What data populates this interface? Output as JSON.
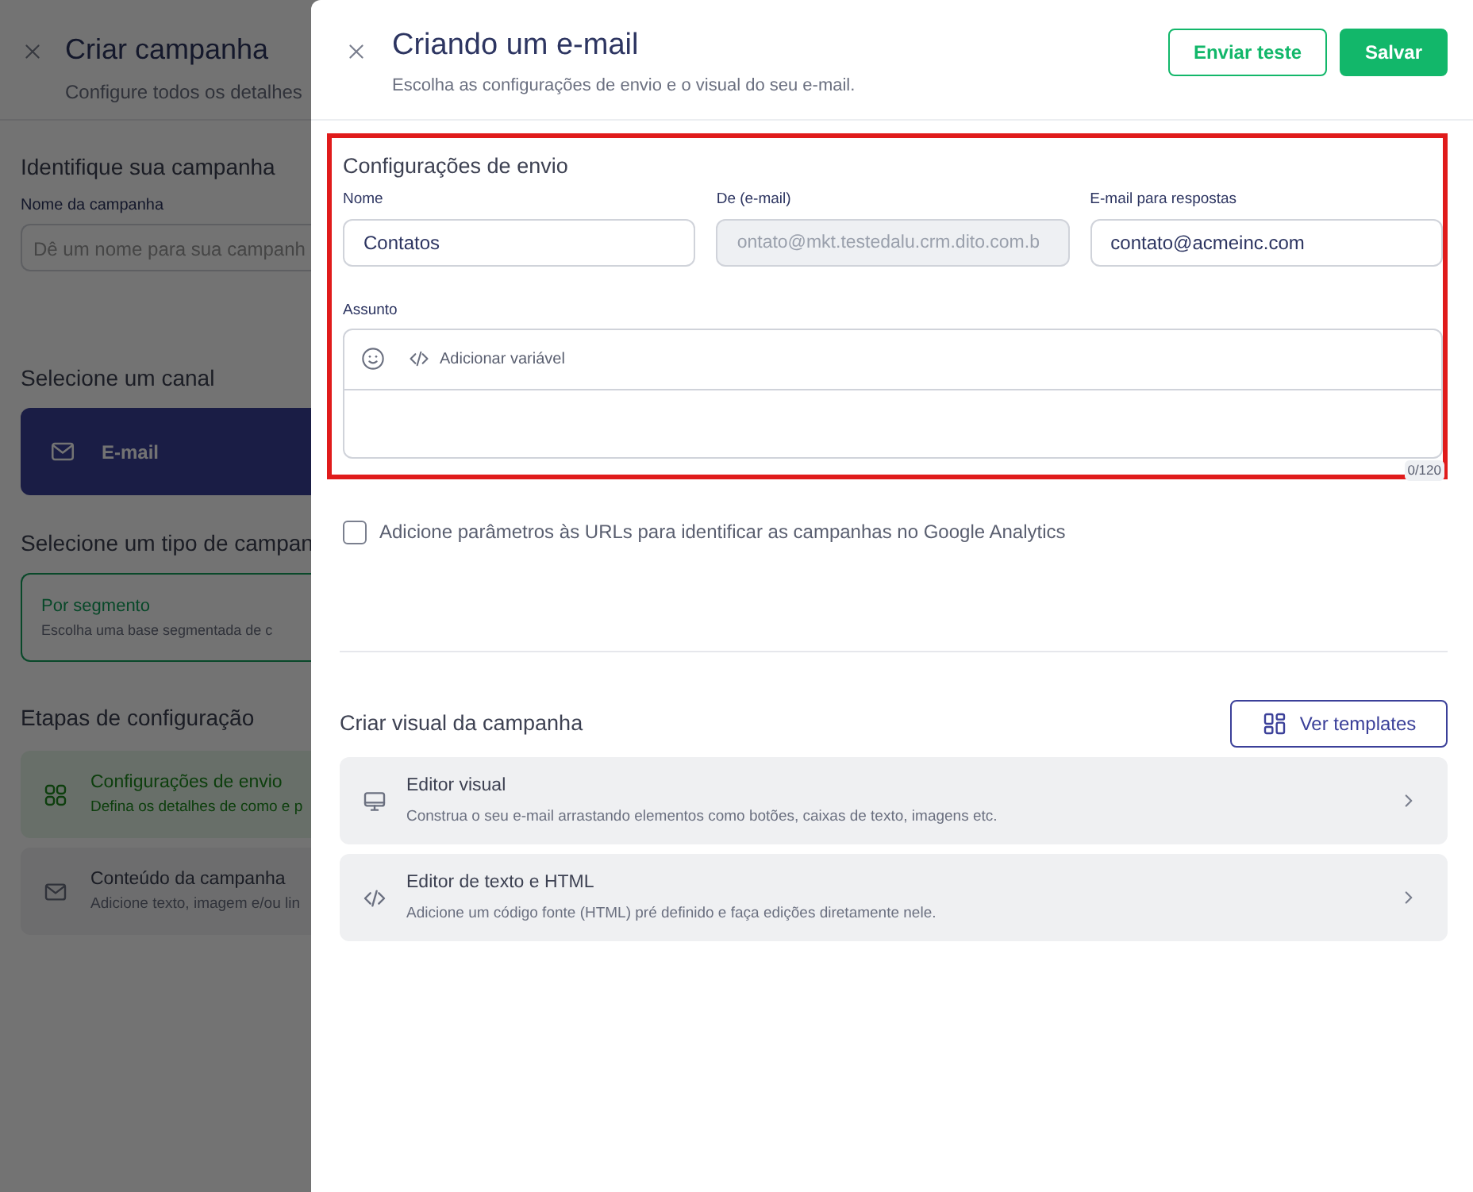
{
  "background_page": {
    "title": "Criar campanha",
    "subtitle": "Configure todos os detalhes",
    "identify": {
      "heading": "Identifique sua campanha",
      "label": "Nome da campanha",
      "placeholder": "Dê um nome para sua campanh"
    },
    "channel": {
      "heading": "Selecione um canal",
      "options": [
        {
          "label": "E-mail",
          "selected": true
        }
      ]
    },
    "campaign_type": {
      "heading": "Selecione um tipo de campan",
      "options": [
        {
          "title": "Por segmento",
          "description": "Escolha uma base segmentada de c",
          "selected": true
        }
      ]
    },
    "steps": {
      "heading": "Etapas de configuração",
      "items": [
        {
          "kind": "grid",
          "title": "Configurações de envio",
          "description": "Defina os detalhes de como e p",
          "selected": true
        },
        {
          "kind": "mail",
          "title": "Conteúdo da campanha",
          "description": "Adicione texto, imagem e/ou lin",
          "selected": false
        }
      ]
    }
  },
  "drawer": {
    "title": "Criando um e-mail",
    "subtitle": "Escolha as configurações de envio e o visual do seu e-mail.",
    "buttons": [
      {
        "label": "Enviar teste",
        "kind": "outline"
      },
      {
        "label": "Salvar",
        "kind": "primary"
      }
    ],
    "send_settings": {
      "heading": "Configurações de envio",
      "highlighted": true,
      "fields": [
        {
          "label": "Nome",
          "value": "Contatos",
          "disabled": false
        },
        {
          "label": "De (e-mail)",
          "value": "ontato@mkt.testedalu.crm.dito.com.b",
          "disabled": true
        },
        {
          "label": "E-mail para respostas",
          "value": "contato@acmeinc.com",
          "disabled": false
        }
      ],
      "subject": {
        "label": "Assunto",
        "toolbar_action": "Adicionar variável",
        "counter": "0/120"
      }
    },
    "utm_option": {
      "label": "Adicione parâmetros às URLs para identificar as campanhas no Google Analytics",
      "checked": false
    },
    "visual": {
      "heading": "Criar visual da campanha",
      "templates_button": "Ver templates",
      "editors": [
        {
          "kind": "visual",
          "title": "Editor visual",
          "description": "Construa o seu e-mail arrastando elementos como botões, caixas de texto, imagens etc."
        },
        {
          "kind": "code",
          "title": "Editor de texto e HTML",
          "description": "Adicione um código fonte (HTML) pré definido e faça edições diretamente nele."
        }
      ]
    }
  }
}
